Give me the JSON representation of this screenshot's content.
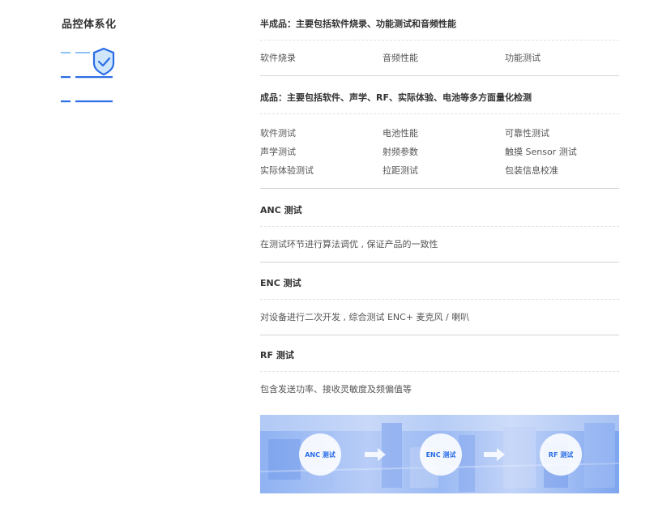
{
  "left": {
    "title": "品控体系化"
  },
  "semi": {
    "title": "半成品：主要包括软件烧录、功能测试和音频性能",
    "items": [
      "软件烧录",
      "音频性能",
      "功能测试"
    ]
  },
  "finished": {
    "title": "成品：主要包括软件、声学、RF、实际体验、电池等多方面量化检测",
    "items": [
      [
        "软件测试",
        "电池性能",
        "可靠性测试"
      ],
      [
        "声学测试",
        "射频参数",
        "触摸 Sensor 测试"
      ],
      [
        "实际体验测试",
        "拉距测试",
        "包装信息校准"
      ]
    ]
  },
  "anc": {
    "title": "ANC 测试",
    "desc": "在测试环节进行算法调优 , 保证产品的一致性"
  },
  "enc": {
    "title": "ENC 测试",
    "desc": "对设备进行二次开发 , 综合测试 ENC+ 麦克风 / 喇叭"
  },
  "rf": {
    "title": "RF 测试",
    "desc": "包含发送功率、接收灵敏度及频偏值等"
  },
  "banner": {
    "labels": [
      "ANC 测试",
      "ENC 测试",
      "RF 测试"
    ]
  },
  "colors": {
    "accent": "#2b6ee6",
    "light_accent": "#8ec2f4",
    "divider": "#d4d4d4"
  }
}
